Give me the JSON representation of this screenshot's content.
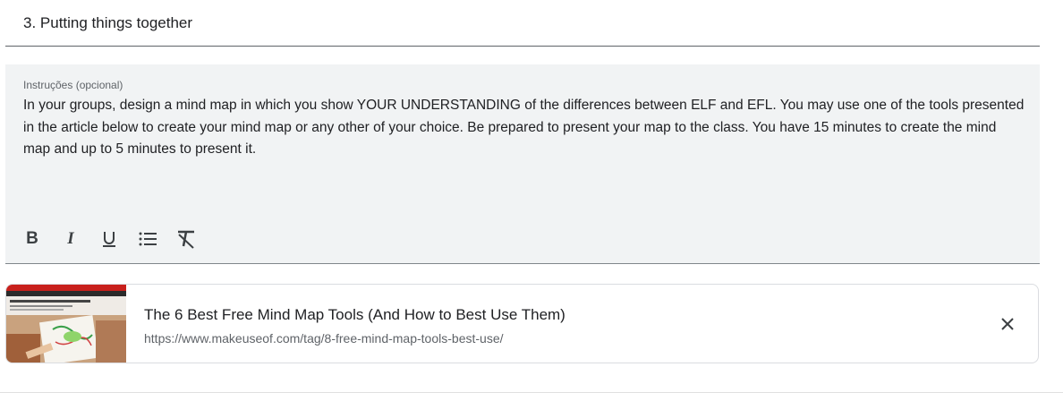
{
  "section": {
    "title": "3. Putting things together"
  },
  "instructions": {
    "label": "Instruções (opcional)",
    "text": "In your groups, design a mind map in which you show YOUR UNDERSTANDING of the differences between ELF and EFL. You may use one of the tools presented in the article below to create your mind map or any other of your choice. Be prepared to present your map to the class. You have 15 minutes to create the mind map and up to 5 minutes to present it."
  },
  "toolbar": {
    "bold_label": "B",
    "italic_label": "I",
    "icons": [
      "underline-icon",
      "bulleted-list-icon",
      "clear-formatting-icon"
    ]
  },
  "link_card": {
    "title": "The 6 Best Free Mind Map Tools (And How to Best Use Them)",
    "url": "https://www.makeuseof.com/tag/8-free-mind-map-tools-best-use/",
    "close_icon": "close-icon"
  },
  "colors": {
    "text": "#202124",
    "secondary_text": "#5f6368",
    "field_background": "#f1f3f4",
    "border": "#dadce0"
  }
}
